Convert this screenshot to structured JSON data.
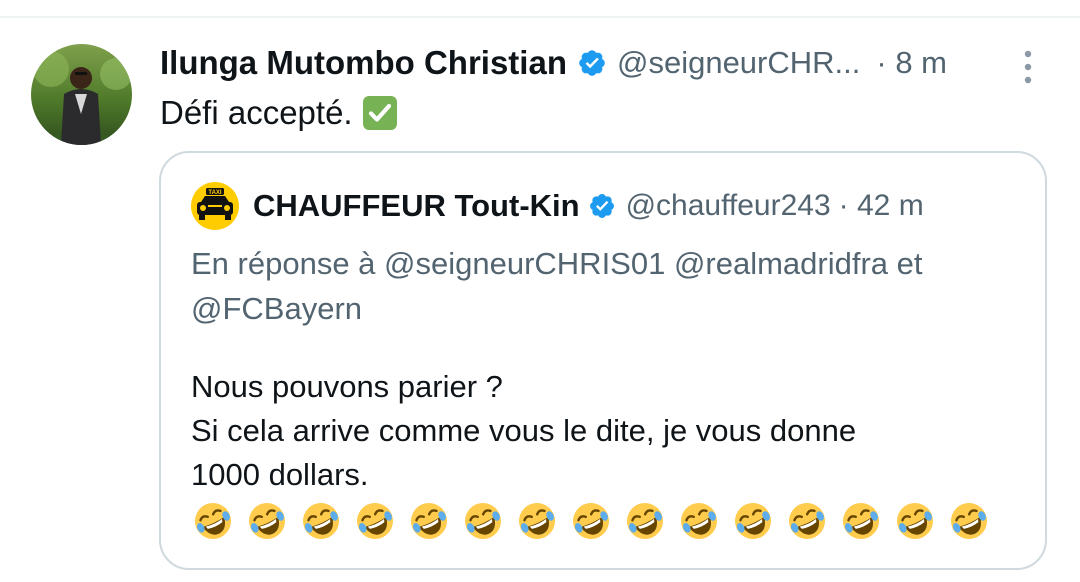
{
  "tweet": {
    "display_name": "Ilunga Mutombo Christian",
    "handle": "@seigneurCHR...",
    "separator": "·",
    "time": "8 m",
    "text": "Défi accepté.",
    "text_emoji": "white-heavy-check-mark-icon"
  },
  "quoted_tweet": {
    "display_name": "CHAUFFEUR Tout-Kin",
    "handle": "@chauffeur243",
    "separator": "·",
    "time": "42 m",
    "avatar_label": "TAXI",
    "reply_context": "En réponse à @seigneurCHRIS01 @realmadridfra et @FCBayern",
    "body_lines": [
      "Nous pouvons parier ?",
      "Si cela arrive comme vous le dite, je vous donne",
      "1000 dollars."
    ],
    "emoji_count": 15,
    "emoji_name": "rolling-on-the-floor-laughing-icon"
  },
  "colors": {
    "text_primary": "#0f1419",
    "text_secondary": "#536471",
    "verified_blue": "#1d9bf0",
    "border": "#cfd9de",
    "check_green": "#77b255",
    "emoji_yellow": "#ffcc4d"
  }
}
